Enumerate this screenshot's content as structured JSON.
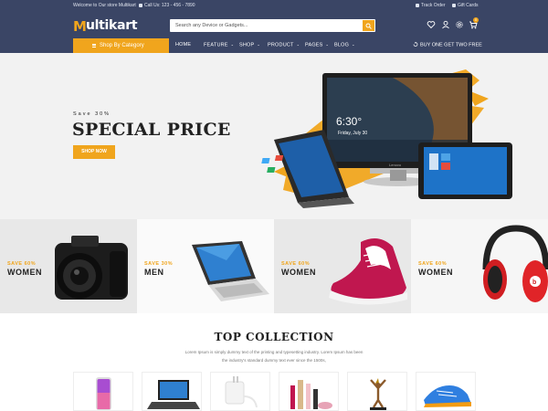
{
  "topbar": {
    "welcome": "Welcome to Our store Multikart",
    "call": "Call Us: 123 - 456 - 7890",
    "track_order": "Track Order",
    "gift_cards": "Gift Cards"
  },
  "logo": {
    "first": "M",
    "rest": "ultikart"
  },
  "search": {
    "placeholder": "Search any Device or Gadgets..."
  },
  "cart": {
    "count": "0"
  },
  "nav": {
    "shop_by_category": "Shop By Category",
    "items": [
      {
        "label": "HOME",
        "chevron": ""
      },
      {
        "label": "FEATURE",
        "chevron": "⌄"
      },
      {
        "label": "SHOP",
        "chevron": "⌄"
      },
      {
        "label": "PRODUCT",
        "chevron": "⌄"
      },
      {
        "label": "PAGES",
        "chevron": "⌄"
      },
      {
        "label": "BLOG",
        "chevron": "⌄"
      }
    ],
    "promo": "BUY ONE GET TWO FREE"
  },
  "hero": {
    "save_text": "Save 30%",
    "title": "SPECIAL PRICE",
    "button": "SHOP NOW",
    "screen_time": "6:30°",
    "screen_date": "Friday, July 30",
    "laptop_brand": "Lenovo"
  },
  "categories": [
    {
      "save": "SAVE 60%",
      "name": "WOMEN",
      "product": "camera"
    },
    {
      "save": "SAVE 30%",
      "name": "MEN",
      "product": "laptop"
    },
    {
      "save": "SAVE 60%",
      "name": "WOMEN",
      "product": "sneaker"
    },
    {
      "save": "SAVE 60%",
      "name": "WOMEN",
      "product": "headphones"
    }
  ],
  "collection": {
    "title": "TOP COLLECTION",
    "line1": "Lorem Ipsum is simply dummy text of the printing and typesetting industry. Lorem Ipsum has been",
    "line2": "the industry's standard dummy text ever since the 1500s,"
  },
  "products": [
    "smartphone",
    "laptop",
    "charger",
    "cosmetics",
    "statue",
    "running-shoe"
  ],
  "colors": {
    "navy": "#3a4565",
    "accent": "#f0a51d"
  },
  "icons": [
    "phone-icon",
    "location-icon",
    "gift-icon",
    "search-icon",
    "heart-icon",
    "user-icon",
    "gear-icon",
    "cart-icon",
    "menu-icon",
    "refresh-icon"
  ]
}
